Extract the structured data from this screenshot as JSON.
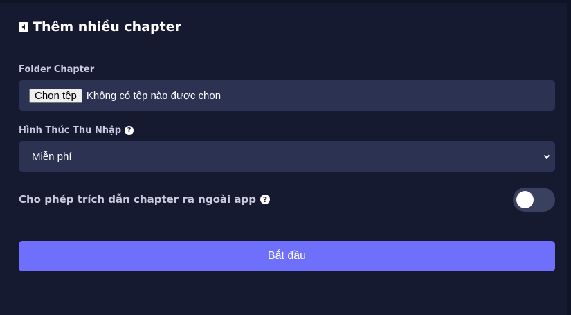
{
  "header": {
    "title": "Thêm nhiều chapter",
    "back_icon": "caret-left-square-icon"
  },
  "folder": {
    "label": "Folder Chapter",
    "button_label": "Chọn tệp",
    "status": "Không có tệp nào được chọn"
  },
  "income": {
    "label": "Hình Thức Thu Nhập",
    "help_icon": "?",
    "selected": "Miễn phí"
  },
  "quote": {
    "label": "Cho phép trích dẫn chapter ra ngoài app",
    "help_icon": "?",
    "enabled": false
  },
  "actions": {
    "start_label": "Bắt đầu"
  },
  "colors": {
    "background": "#151a30",
    "field": "#2b3252",
    "accent": "#6e6ffb",
    "toggle_off": "#3a4060"
  }
}
